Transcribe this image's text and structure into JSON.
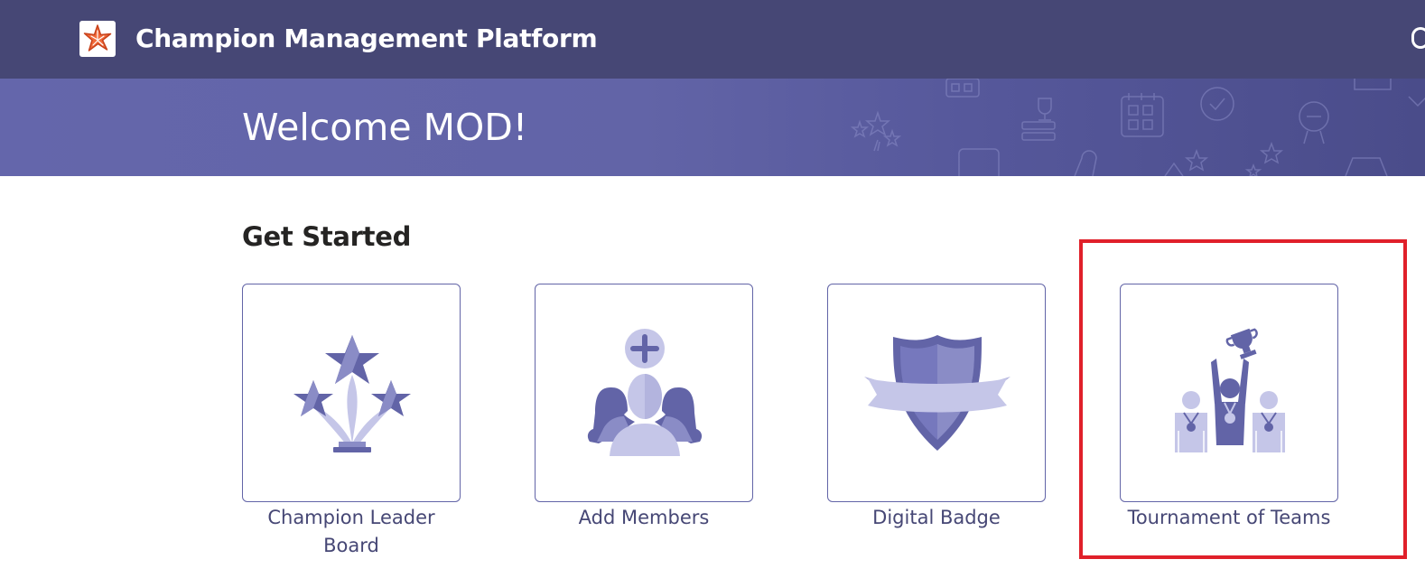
{
  "header": {
    "app_title": "Champion Management Platform",
    "logo_icon": "starfish-logo-icon"
  },
  "banner": {
    "welcome_text": "Welcome MOD!"
  },
  "main": {
    "section_title": "Get Started",
    "tiles": [
      {
        "label": "Champion Leader Board",
        "icon": "stars-trophy-icon"
      },
      {
        "label": "Add Members",
        "icon": "add-members-icon"
      },
      {
        "label": "Digital Badge",
        "icon": "badge-shield-icon"
      },
      {
        "label": "Tournament of Teams",
        "icon": "team-trophy-icon"
      }
    ]
  },
  "colors": {
    "header_bg": "#464775",
    "banner_bg": "#6264a7",
    "accent": "#6264a7",
    "icon_dark": "#6264a7",
    "icon_light": "#c5c6e8",
    "highlight": "#e0202a"
  }
}
